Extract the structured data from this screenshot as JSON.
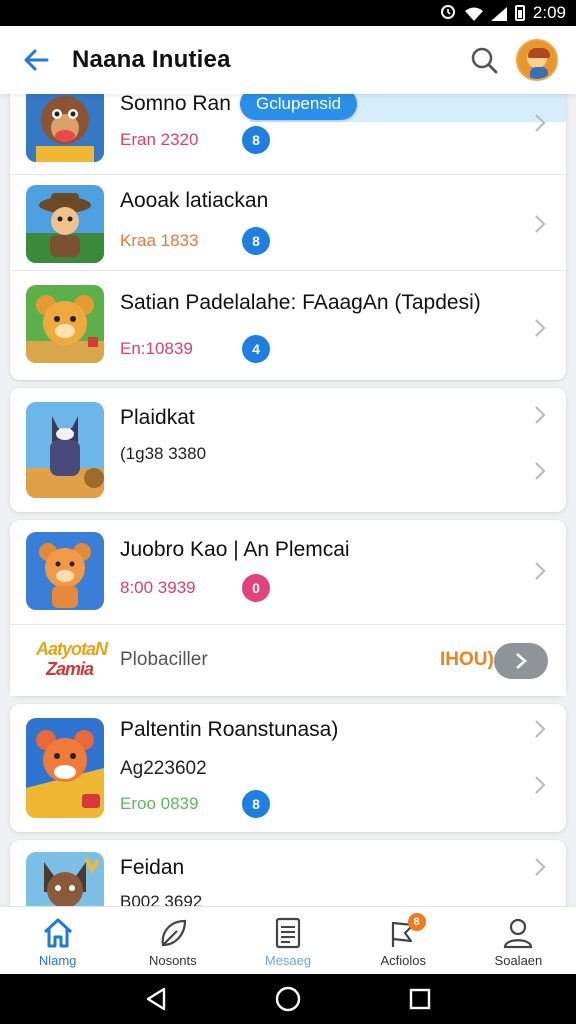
{
  "status_bar": {
    "time": "2:09"
  },
  "app_bar": {
    "title": "Naana Inutiea"
  },
  "list": {
    "highlight_pill": "Gclupensid",
    "items": [
      {
        "title": "Somno Ran",
        "sub": "Eran 2320",
        "sub_color": "#d9416a",
        "badge": "8",
        "badge_color": "#1f7fe0"
      },
      {
        "title": "Aooak latiackan",
        "sub": "Kraa 1833",
        "sub_color": "#e27a3a",
        "badge": "8",
        "badge_color": "#1f7fe0"
      },
      {
        "title": "Satian Padelalahe: FAaagAn (Tapdesi)",
        "sub": "En:10839",
        "sub_color": "#d9416a",
        "badge": "4",
        "badge_color": "#1f7fe0"
      },
      {
        "title": "Plaidkat",
        "sub": "(1g38 3380",
        "sub_color": "#222222"
      },
      {
        "title": "Juobro Kao | An Plemcai",
        "sub": "8:00 3939",
        "sub_color": "#d9416a",
        "badge": "0",
        "badge_color": "#e0447a"
      },
      {
        "title": "Paltentin Roanstunasa)",
        "sub": "Ag223602",
        "sub_color": "#222222",
        "sub2": "Eroo 0839",
        "sub2_color": "#5cb85c",
        "badge": "8",
        "badge_color": "#1f7fe0"
      },
      {
        "title": "Feidan",
        "sub": "B002 3692",
        "sub_color": "#222222"
      }
    ]
  },
  "ad": {
    "logo_line1": "AatyotaN",
    "logo_line2": "Zamia",
    "label": "Plobaciller",
    "tag": "IHOU)"
  },
  "bottom_nav": [
    {
      "label": "Nlamg",
      "icon": "home-icon"
    },
    {
      "label": "Nosonts",
      "icon": "leaf-icon"
    },
    {
      "label": "Mesaeg",
      "icon": "document-icon"
    },
    {
      "label": "Acfiolos",
      "icon": "flag-icon",
      "badge": "8"
    },
    {
      "label": "Soalaen",
      "icon": "person-icon"
    }
  ]
}
